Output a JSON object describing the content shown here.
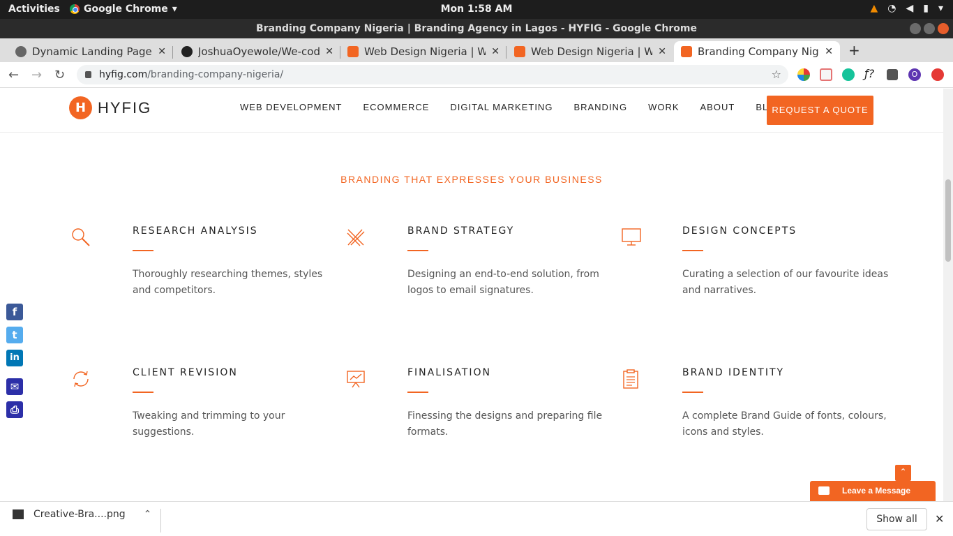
{
  "system": {
    "activities": "Activities",
    "app_name": "Google Chrome",
    "clock": "Mon  1:58 AM"
  },
  "window": {
    "title": "Branding Company Nigeria | Branding Agency in Lagos - HYFIG - Google Chrome"
  },
  "tabs": [
    {
      "label": "Dynamic Landing Page",
      "favicon": "globe-icon"
    },
    {
      "label": "JoshuaOyewole/We-code",
      "favicon": "github-icon"
    },
    {
      "label": "Web Design Nigeria | Web",
      "favicon": "hyfig-icon"
    },
    {
      "label": "Web Design Nigeria | Web",
      "favicon": "hyfig-icon"
    },
    {
      "label": "Branding Company Nigeri",
      "favicon": "hyfig-icon"
    }
  ],
  "address": {
    "host": "hyfig.com",
    "path": "/branding-company-nigeria/"
  },
  "site": {
    "logo_text": "HYFIG",
    "logo_mark": "H",
    "nav": [
      "WEB DEVELOPMENT",
      "ECOMMERCE",
      "DIGITAL MARKETING",
      "BRANDING",
      "WORK",
      "ABOUT",
      "BLOG"
    ],
    "cta": "REQUEST A QUOTE",
    "brand_color": "#f26522"
  },
  "section_title": "BRANDING THAT EXPRESSES YOUR BUSINESS",
  "features": [
    {
      "title": "RESEARCH ANALYSIS",
      "text": "Thoroughly researching themes, styles and competitors.",
      "icon": "magnifier-icon"
    },
    {
      "title": "BRAND STRATEGY",
      "text": "Designing an end-to-end solution, from logos to email signatures.",
      "icon": "pencil-ruler-icon"
    },
    {
      "title": "DESIGN CONCEPTS",
      "text": "Curating a selection of our favourite ideas and narratives.",
      "icon": "monitor-icon"
    },
    {
      "title": "CLIENT REVISION",
      "text": "Tweaking and trimming to your suggestions.",
      "icon": "refresh-icon"
    },
    {
      "title": "FINALISATION",
      "text": "Finessing the designs and preparing file formats.",
      "icon": "presentation-icon"
    },
    {
      "title": "BRAND IDENTITY",
      "text": "A complete Brand Guide of fonts, colours, icons and styles.",
      "icon": "clipboard-icon"
    }
  ],
  "social": {
    "facebook": "f",
    "twitter": "t",
    "linkedin": "in",
    "email": "✉",
    "print": "⎙"
  },
  "chat": {
    "label": "Leave a Message"
  },
  "downloads": {
    "file": "Creative-Bra....png",
    "show_all": "Show all"
  }
}
